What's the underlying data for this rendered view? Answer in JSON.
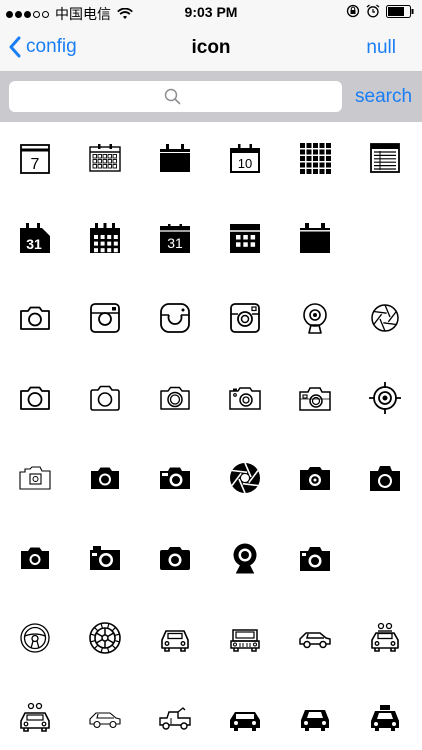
{
  "status_bar": {
    "carrier": "中国电信",
    "time": "9:03 PM",
    "signal_icon": "signal-dots-icon",
    "wifi_icon": "wifi-icon",
    "right_icons": [
      "orientation-lock-icon",
      "alarm-icon",
      "battery-icon"
    ]
  },
  "nav": {
    "back_label": "config",
    "title": "icon",
    "right_label": "null"
  },
  "search": {
    "placeholder": "",
    "value": "",
    "button_label": "search"
  },
  "icons": [
    [
      "calendar-7",
      "calendar-outline-grid",
      "calendar-solid",
      "calendar-10",
      "grid-solid",
      "spreadsheet"
    ],
    [
      "calendar-31-solid",
      "calendar-solid-grid",
      "calendar-31",
      "calendar-grid-bar",
      "calendar-blank-solid"
    ],
    [
      "camera-outline",
      "instagram",
      "instagram-rounded",
      "instagram-alt",
      "webcam",
      "aperture-outline"
    ],
    [
      "camera-thin",
      "camera-outline-round",
      "camera-lens",
      "camera-flash",
      "camera-retro",
      "target"
    ],
    [
      "camera-light",
      "camera-solid",
      "camera-solid-alt",
      "aperture-solid",
      "camera-solid-lens",
      "camera-solid-square"
    ],
    [
      "camera-solid-small",
      "camera-solid-retro",
      "camera-solid-rounded",
      "webcam-solid",
      "camera-solid-lens-alt"
    ],
    [
      "steering-wheel",
      "tire",
      "car-front",
      "jeep-front",
      "car-side",
      "taxi-front"
    ],
    [
      "taxi-front-alt",
      "car-side-thin",
      "jeep-side",
      "car-front-solid",
      "car-solid",
      "taxi-solid"
    ]
  ]
}
